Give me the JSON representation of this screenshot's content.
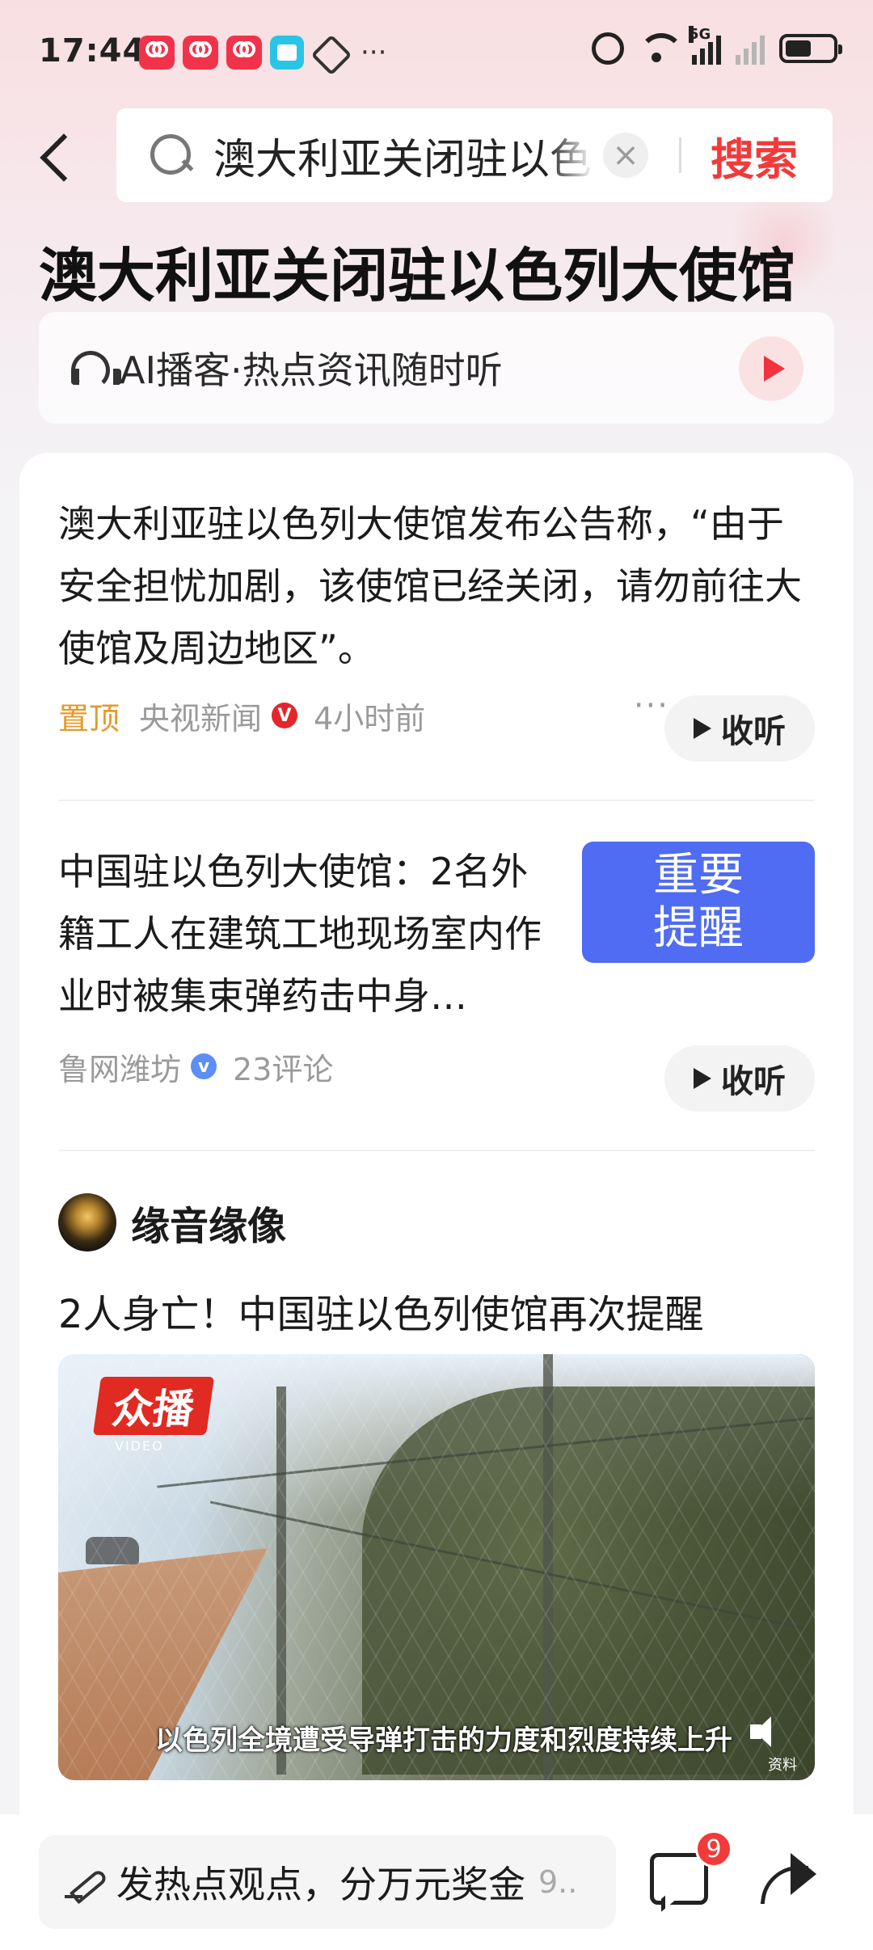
{
  "status_bar": {
    "time": "17:44",
    "network": "5G",
    "more": "···"
  },
  "search": {
    "query": "澳大利亚关闭驻以色列大使馆",
    "clear_symbol": "×",
    "submit_label": "搜索"
  },
  "topic": {
    "title": "澳大利亚关闭驻以色列大使馆"
  },
  "podcast": {
    "label": "AI播客·热点资讯随时听"
  },
  "feed": {
    "pinned": {
      "text": "澳大利亚驻以色列大使馆发布公告称，“由于安全担忧加剧，该使馆已经关闭，请勿前往大使馆及周边地区”。",
      "pin_label": "置顶",
      "source": "央视新闻",
      "verified_mark": "V",
      "time": "4小时前",
      "more": "···",
      "listen_label": "收听"
    },
    "article": {
      "text": "中国驻以色列大使馆：2名外籍工人在建筑工地现场室内作业时被集束弹药击中身…",
      "thumbnail_line1": "重要",
      "thumbnail_line2": "提醒",
      "source": "鲁网潍坊",
      "verified_mark": "v",
      "comments": "23评论",
      "listen_label": "收听"
    },
    "post": {
      "author": "缘音缘像",
      "title": "2人身亡！中国驻以色列使馆再次提醒",
      "video": {
        "logo": "众播",
        "logo_sub": "VIDEO",
        "subtitle": "以色列全境遭受导弹打击的力度和烈度持续上升",
        "corner_tag": "资料"
      }
    }
  },
  "bottom_bar": {
    "comment_placeholder": "发热点观点，分万元奖金",
    "comment_count_inline": "9..",
    "comment_badge": "9"
  }
}
